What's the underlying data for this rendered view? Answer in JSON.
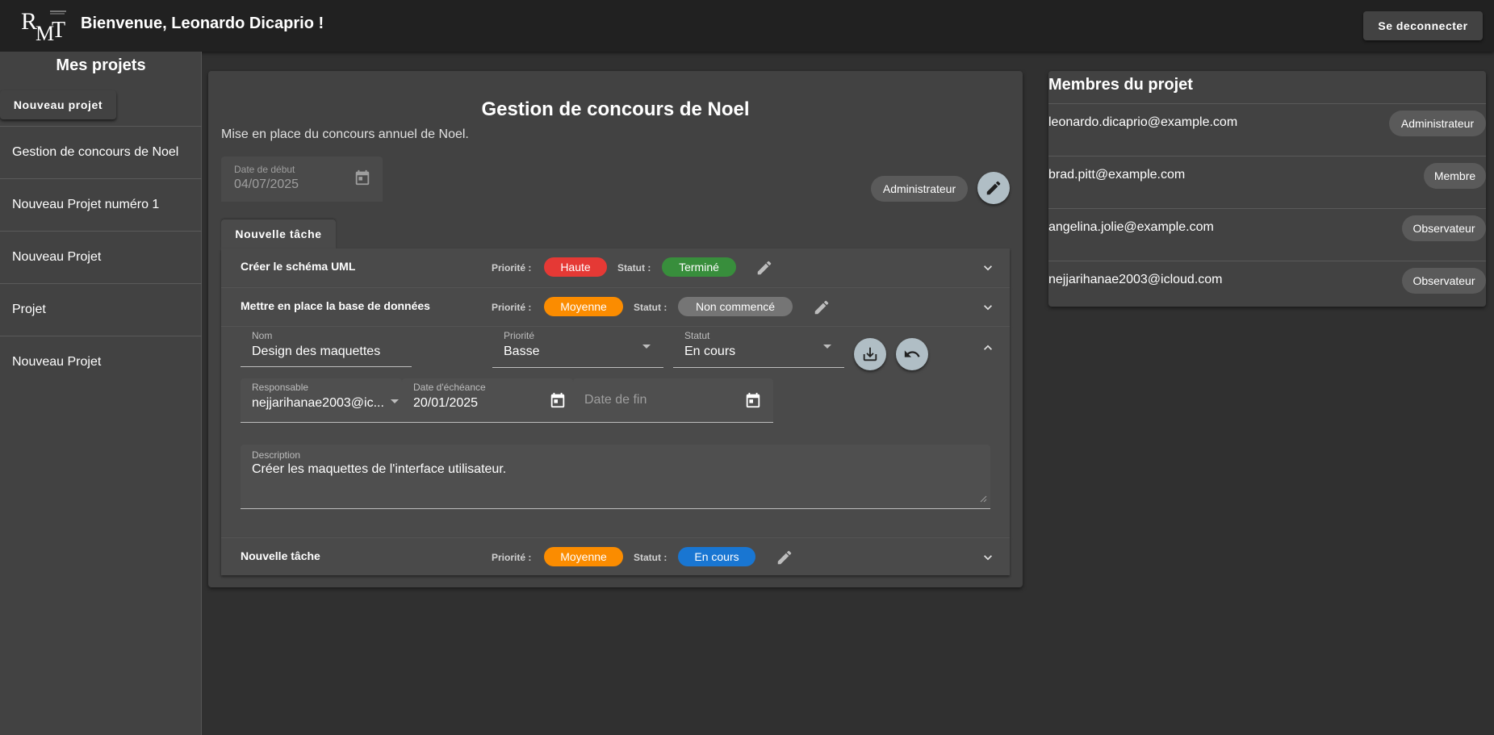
{
  "header": {
    "welcome": "Bienvenue, Leonardo Dicaprio !",
    "logout_label": "Se deconnecter",
    "logo_icon": "rmt-logo"
  },
  "sidebar": {
    "title": "Mes projets",
    "new_project_label": "Nouveau projet",
    "projects": [
      "Gestion de concours de Noel",
      "Nouveau Projet numéro 1",
      "Nouveau Projet",
      "Projet",
      "Nouveau Projet"
    ]
  },
  "project": {
    "title": "Gestion de concours de Noel",
    "description": "Mise en place du concours annuel de Noel.",
    "start_date_label": "Date de début",
    "start_date_value": "04/07/2025",
    "role": "Administrateur",
    "new_task_label": "Nouvelle tâche"
  },
  "tasks": [
    {
      "name": "Créer le schéma UML",
      "priority_label": "Priorité :",
      "priority": "Haute",
      "priority_color": "#e53935",
      "status_label": "Statut :",
      "status": "Terminé",
      "status_color": "#388e3c"
    },
    {
      "name": "Mettre en place la base de données",
      "priority_label": "Priorité :",
      "priority": "Moyenne",
      "priority_color": "#fb8c00",
      "status_label": "Statut :",
      "status": "Non commencé",
      "status_color": "#757575"
    },
    {
      "name": "Nouvelle tâche",
      "priority_label": "Priorité :",
      "priority": "Moyenne",
      "priority_color": "#fb8c00",
      "status_label": "Statut :",
      "status": "En cours",
      "status_color": "#1976d2"
    }
  ],
  "edit_task": {
    "name_label": "Nom",
    "name_value": "Design des maquettes",
    "priority_label": "Priorité",
    "priority_value": "Basse",
    "status_label": "Statut",
    "status_value": "En cours",
    "owner_label": "Responsable",
    "owner_value": "nejjarihanae2003@ic...",
    "due_label": "Date d'échéance",
    "due_value": "20/01/2025",
    "end_placeholder": "Date de fin",
    "description_label": "Description",
    "description_value": "Créer les maquettes de l'interface utilisateur."
  },
  "members": {
    "title": "Membres du projet",
    "list": [
      {
        "email": "leonardo.dicaprio@example.com",
        "role": "Administrateur"
      },
      {
        "email": "brad.pitt@example.com",
        "role": "Membre"
      },
      {
        "email": "angelina.jolie@example.com",
        "role": "Observateur"
      },
      {
        "email": "nejjarihanae2003@icloud.com",
        "role": "Observateur"
      }
    ]
  },
  "colors": {
    "background": "#303030",
    "surface": "#424242",
    "topbar": "#212121",
    "fab": "#b0bec5"
  }
}
